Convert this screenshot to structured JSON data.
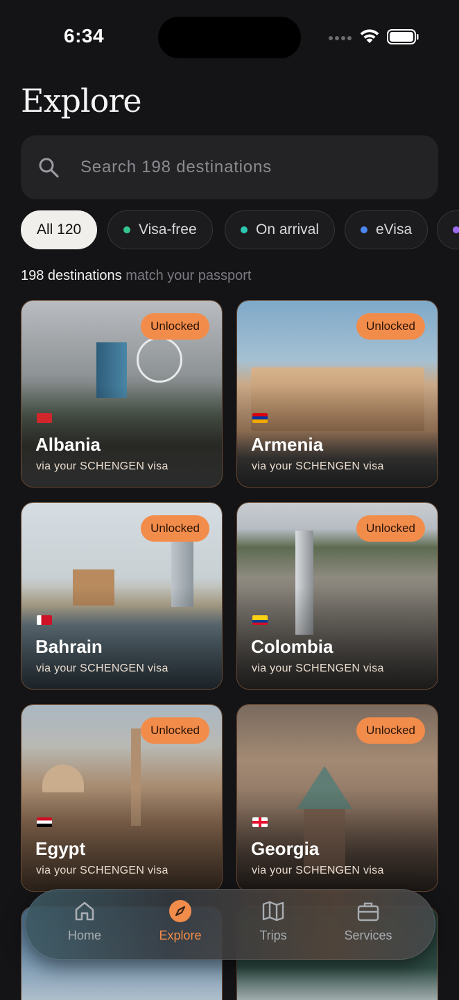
{
  "status_bar": {
    "time": "6:34"
  },
  "header": {
    "title": "Explore"
  },
  "search": {
    "placeholder": "Search 198 destinations"
  },
  "filters": [
    {
      "label": "All 120",
      "active": true,
      "dot": null
    },
    {
      "label": "Visa-free",
      "active": false,
      "dot": "#35c48e"
    },
    {
      "label": "On arrival",
      "active": false,
      "dot": "#2fc7b0"
    },
    {
      "label": "eVisa",
      "active": false,
      "dot": "#4d86f0"
    },
    {
      "label": "",
      "active": false,
      "dot": "#9b6cf0"
    }
  ],
  "results": {
    "count": "198 destinations",
    "suffix": "match your passport"
  },
  "destinations": [
    {
      "name": "Albania",
      "via": "via your SCHENGEN visa",
      "badge": "Unlocked"
    },
    {
      "name": "Armenia",
      "via": "via your SCHENGEN visa",
      "badge": "Unlocked"
    },
    {
      "name": "Bahrain",
      "via": "via your SCHENGEN visa",
      "badge": "Unlocked"
    },
    {
      "name": "Colombia",
      "via": "via your SCHENGEN visa",
      "badge": "Unlocked"
    },
    {
      "name": "Egypt",
      "via": "via your SCHENGEN visa",
      "badge": "Unlocked"
    },
    {
      "name": "Georgia",
      "via": "via your SCHENGEN visa",
      "badge": "Unlocked"
    }
  ],
  "tab_bar": {
    "items": [
      {
        "label": "Home",
        "icon": "home-icon",
        "active": false
      },
      {
        "label": "Explore",
        "icon": "compass-icon",
        "active": true
      },
      {
        "label": "Trips",
        "icon": "map-icon",
        "active": false
      },
      {
        "label": "Services",
        "icon": "briefcase-icon",
        "active": false
      }
    ]
  },
  "colors": {
    "accent": "#f28c4b",
    "background": "#141416",
    "surface": "#232326"
  }
}
